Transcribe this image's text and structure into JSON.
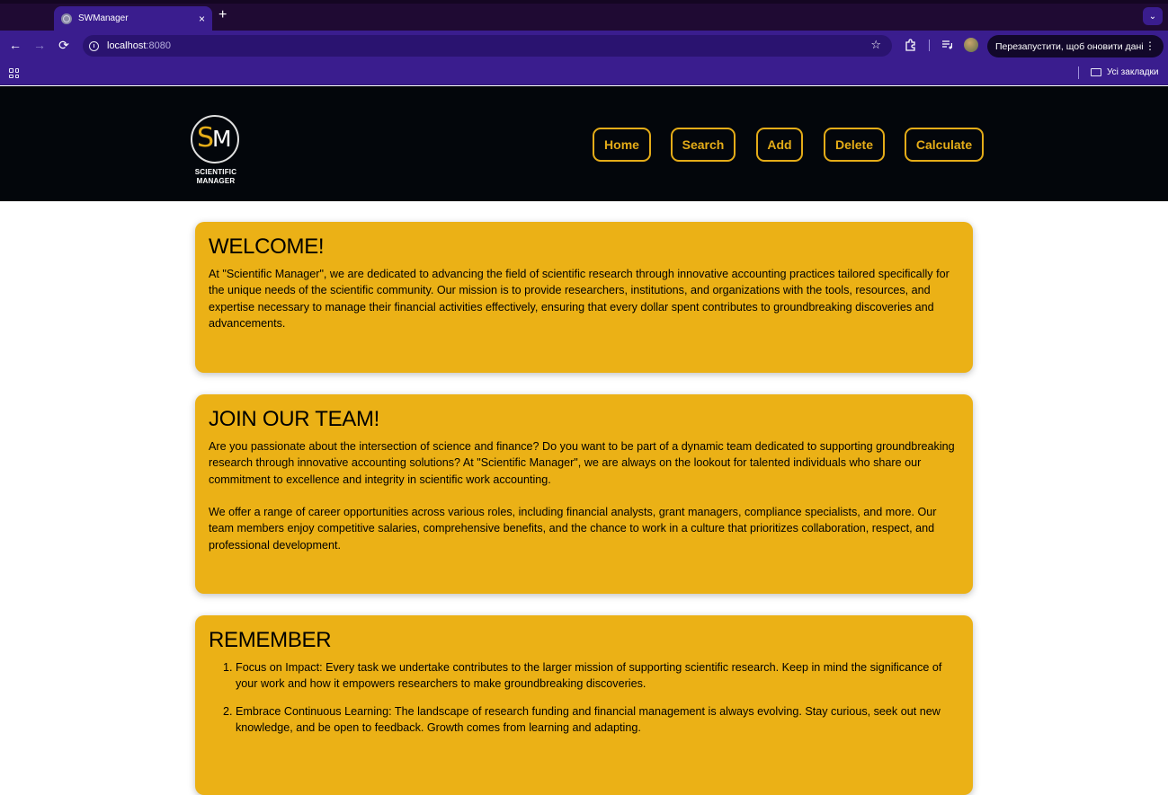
{
  "browser": {
    "tab_title": "SWManager",
    "tab_close": "×",
    "new_tab": "+",
    "tabs_menu": "⌄",
    "nav": {
      "back": "←",
      "forward": "→",
      "reload": "⟳"
    },
    "url_host": "localhost",
    "url_port": ":8080",
    "star": "☆",
    "update_label": "Перезапустити, щоб оновити дані",
    "kebab": "⋮",
    "bookmarks_label": "Усі закладки"
  },
  "site": {
    "logo_line1": "SCIENTIFIC",
    "logo_line2": "MANAGER",
    "logo_s": "S",
    "logo_m": "M",
    "nav": [
      "Home",
      "Search",
      "Add",
      "Delete",
      "Calculate"
    ]
  },
  "sections": {
    "welcome": {
      "title": "WELCOME!",
      "body": "At \"Scientific Manager\", we are dedicated to advancing the field of scientific research through innovative accounting practices tailored specifically for the unique needs of the scientific community. Our mission is to provide researchers, institutions, and organizations with the tools, resources, and expertise necessary to manage their financial activities effectively, ensuring that every dollar spent contributes to groundbreaking discoveries and advancements."
    },
    "join": {
      "title": "JOIN OUR TEAM!",
      "body1": "Are you passionate about the intersection of science and finance? Do you want to be part of a dynamic team dedicated to supporting groundbreaking research through innovative accounting solutions? At \"Scientific Manager\", we are always on the lookout for talented individuals who share our commitment to excellence and integrity in scientific work accounting.",
      "body2": "We offer a range of career opportunities across various roles, including financial analysts, grant managers, compliance specialists, and more. Our team members enjoy competitive salaries, comprehensive benefits, and the chance to work in a culture that prioritizes collaboration, respect, and professional development."
    },
    "remember": {
      "title": "REMEMBER",
      "items": [
        "Focus on Impact: Every task we undertake contributes to the larger mission of supporting scientific research. Keep in mind the significance of your work and how it empowers researchers to make groundbreaking discoveries.",
        "Embrace Continuous Learning: The landscape of research funding and financial management is always evolving. Stay curious, seek out new knowledge, and be open to feedback. Growth comes from learning and adapting."
      ]
    }
  },
  "colors": {
    "accent": "#ebb116",
    "header_bg": "#03060b",
    "chrome": "#3a1d8e"
  }
}
